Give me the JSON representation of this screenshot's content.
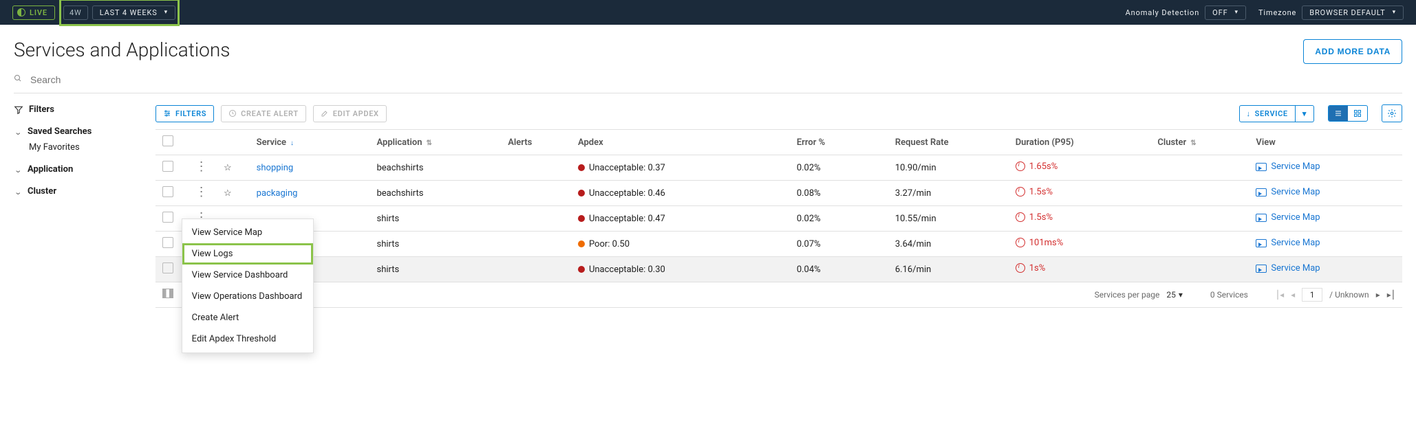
{
  "topbar": {
    "live": "LIVE",
    "fourw": "4W",
    "timerange": "LAST 4 WEEKS",
    "anomaly_label": "Anomaly Detection",
    "anomaly_value": "OFF",
    "tz_label": "Timezone",
    "tz_value": "BROWSER DEFAULT"
  },
  "page": {
    "title": "Services and Applications",
    "add_data": "ADD MORE DATA",
    "search_placeholder": "Search"
  },
  "sidebar": {
    "filters_title": "Filters",
    "saved_searches": "Saved Searches",
    "my_favorites": "My Favorites",
    "application": "Application",
    "cluster": "Cluster"
  },
  "toolbar": {
    "filters": "FILTERS",
    "create_alert": "CREATE ALERT",
    "edit_apdex": "EDIT APDEX",
    "service": "SERVICE"
  },
  "cols": {
    "service": "Service",
    "application": "Application",
    "alerts": "Alerts",
    "apdex": "Apdex",
    "error": "Error %",
    "request_rate": "Request Rate",
    "duration": "Duration (P95)",
    "cluster": "Cluster",
    "view": "View"
  },
  "rows": [
    {
      "service": "shopping",
      "app": "beachshirts",
      "apdex_severity": "red",
      "apdex_text": "Unacceptable: 0.37",
      "error": "0.02%",
      "rate": "10.90/min",
      "dur": "1.65s%",
      "view": "Service Map",
      "starred": true,
      "sel": false
    },
    {
      "service": "packaging",
      "app": "beachshirts",
      "apdex_severity": "red",
      "apdex_text": "Unacceptable: 0.46",
      "error": "0.08%",
      "rate": "3.27/min",
      "dur": "1.5s%",
      "view": "Service Map",
      "starred": true,
      "sel": false
    },
    {
      "service": "",
      "app": "shirts",
      "apdex_severity": "red",
      "apdex_text": "Unacceptable: 0.47",
      "error": "0.02%",
      "rate": "10.55/min",
      "dur": "1.5s%",
      "view": "Service Map",
      "starred": false,
      "sel": false
    },
    {
      "service": "",
      "app": "shirts",
      "apdex_severity": "orange",
      "apdex_text": "Poor: 0.50",
      "error": "0.07%",
      "rate": "3.64/min",
      "dur": "101ms%",
      "view": "Service Map",
      "starred": false,
      "sel": false
    },
    {
      "service": "",
      "app": "shirts",
      "apdex_severity": "red",
      "apdex_text": "Unacceptable: 0.30",
      "error": "0.04%",
      "rate": "6.16/min",
      "dur": "1s%",
      "view": "Service Map",
      "starred": false,
      "sel": true
    }
  ],
  "menu": {
    "view_service_map": "View Service Map",
    "view_logs": "View Logs",
    "view_service_dashboard": "View Service Dashboard",
    "view_ops_dashboard": "View Operations Dashboard",
    "create_alert": "Create Alert",
    "edit_apdex": "Edit Apdex Threshold"
  },
  "footer": {
    "per_page_label": "Services per page",
    "per_page_value": "25",
    "count_services": "0 Services",
    "page_value": "1",
    "page_total": "/ Unknown"
  }
}
